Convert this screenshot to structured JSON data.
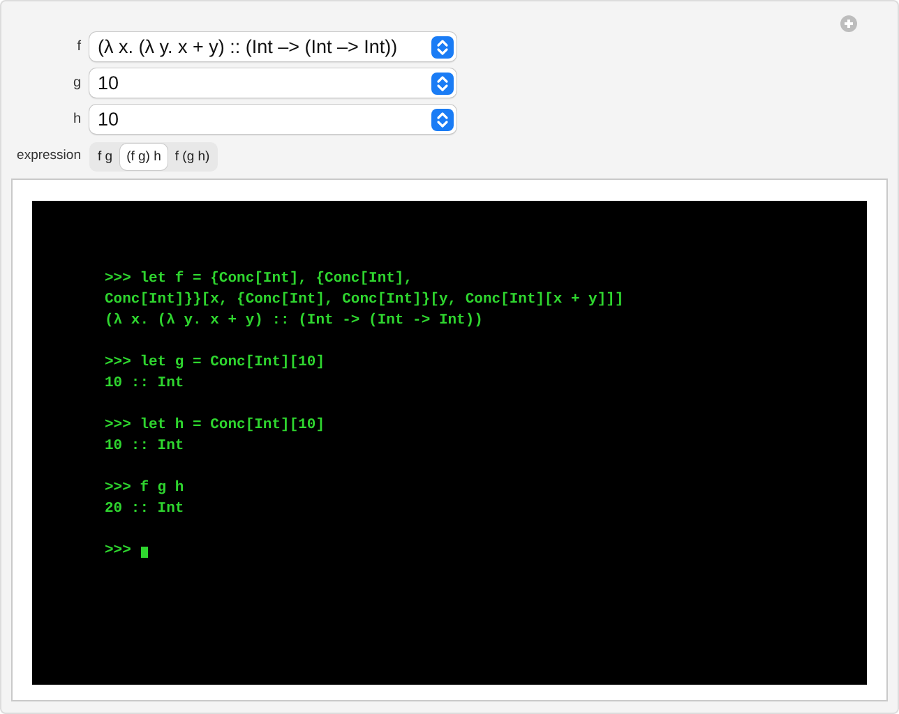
{
  "controls": [
    {
      "label": "f",
      "value": "(λ x. (λ y. x + y) :: (Int –> (Int –> Int))"
    },
    {
      "label": "g",
      "value": "10"
    },
    {
      "label": "h",
      "value": "10"
    }
  ],
  "expression": {
    "label": "expression",
    "options": [
      {
        "label": "f g",
        "selected": false
      },
      {
        "label": "(f g) h",
        "selected": true
      },
      {
        "label": "f (g h)",
        "selected": false
      }
    ]
  },
  "terminal": {
    "blocks": [
      [
        ">>> let f = {Conc[Int], {Conc[Int],",
        "Conc[Int]}}[x, {Conc[Int], Conc[Int]}[y, Conc[Int][x + y]]]",
        "(λ x. (λ y. x + y) :: (Int -> (Int -> Int))"
      ],
      [
        ">>> let g = Conc[Int][10]",
        "10 :: Int"
      ],
      [
        ">>> let h = Conc[Int][10]",
        "10 :: Int"
      ],
      [
        ">>> f g h",
        "20 :: Int"
      ]
    ],
    "prompt": ">>>"
  }
}
